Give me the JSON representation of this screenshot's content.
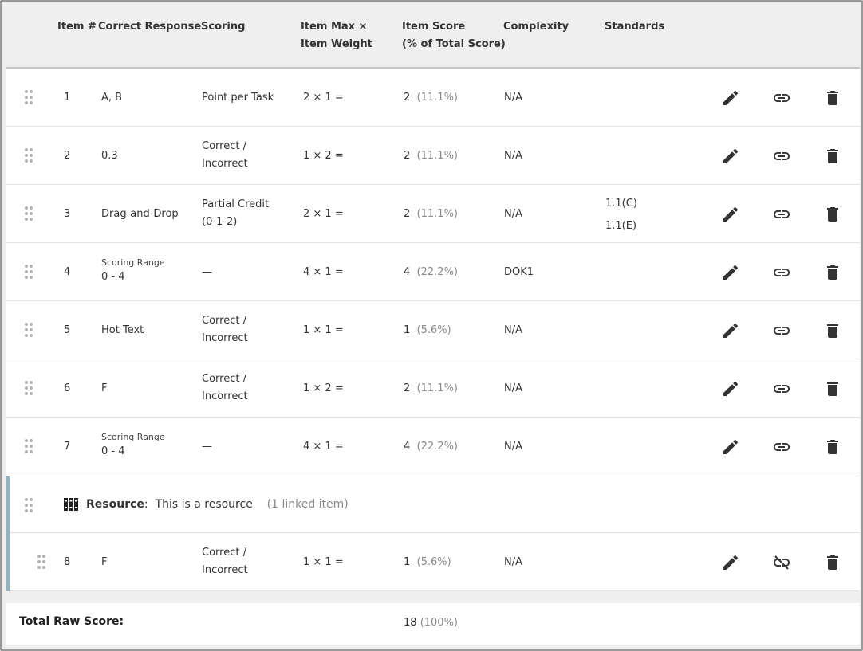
{
  "header": {
    "item_num": "Item #",
    "correct_response": "Correct Response",
    "scoring": "Scoring",
    "item_max_l1": "Item Max ×",
    "item_max_l2": "Item Weight",
    "item_score_l1": "Item Score",
    "item_score_l2": "(% of Total Score)",
    "complexity": "Complexity",
    "standards": "Standards"
  },
  "rows": [
    {
      "num": "1",
      "response": "A, B",
      "scoring": "Point per Task",
      "calc": "2 × 1 =",
      "score": "2",
      "pct": "(11.1%)",
      "complexity": "N/A"
    },
    {
      "num": "2",
      "response": "0.3",
      "scoring_l1": "Correct /",
      "scoring_l2": "Incorrect",
      "calc": "1 × 2 =",
      "score": "2",
      "pct": "(11.1%)",
      "complexity": "N/A"
    },
    {
      "num": "3",
      "response": "Drag-and-Drop",
      "scoring_l1": "Partial Credit",
      "scoring_l2": "(0-1-2)",
      "calc": "2 × 1 =",
      "score": "2",
      "pct": "(11.1%)",
      "complexity": "N/A",
      "standards": [
        "1.1(C)",
        "1.1(E)"
      ]
    },
    {
      "num": "4",
      "response_small": "Scoring Range",
      "response": "0 - 4",
      "scoring": "—",
      "calc": "4 × 1 =",
      "score": "4",
      "pct": "(22.2%)",
      "complexity": "DOK1"
    },
    {
      "num": "5",
      "response": "Hot Text",
      "scoring_l1": "Correct /",
      "scoring_l2": "Incorrect",
      "calc": "1 × 1 =",
      "score": "1",
      "pct": "(5.6%)",
      "complexity": "N/A"
    },
    {
      "num": "6",
      "response": "F",
      "scoring_l1": "Correct /",
      "scoring_l2": "Incorrect",
      "calc": "1 × 2 =",
      "score": "2",
      "pct": "(11.1%)",
      "complexity": "N/A"
    },
    {
      "num": "7",
      "response_small": "Scoring Range",
      "response": "0 - 4",
      "scoring": "—",
      "calc": "4 × 1 =",
      "score": "4",
      "pct": "(22.2%)",
      "complexity": "N/A"
    },
    {
      "num": "8",
      "response": "F",
      "scoring_l1": "Correct /",
      "scoring_l2": "Incorrect",
      "calc": "1 × 1 =",
      "score": "1",
      "pct": "(5.6%)",
      "complexity": "N/A"
    }
  ],
  "resource": {
    "label": "Resource",
    "colon": ":",
    "name": "This is a resource",
    "linked": "(1 linked item)"
  },
  "footer": {
    "label": "Total Raw Score:",
    "score": "18",
    "pct": "(100%)"
  },
  "icons": {
    "edit": "pencil-icon",
    "link": "link-icon",
    "unlink": "unlink-icon",
    "delete": "trash-icon",
    "drag": "drag-handle-icon",
    "resource": "resource-icon"
  },
  "colors": {
    "header_bg": "#efefef",
    "resource_accent": "#8fb4c0",
    "muted": "#8a8a8a"
  }
}
